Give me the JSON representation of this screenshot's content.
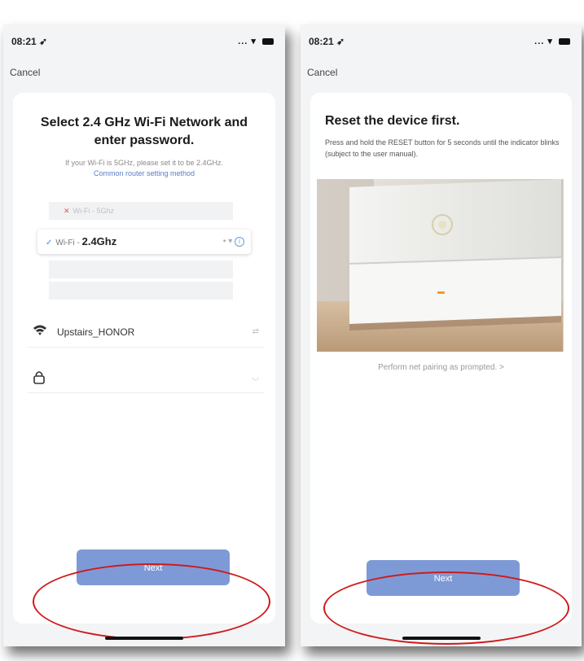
{
  "left": {
    "status_time": "08:21",
    "cancel": "Cancel",
    "title": "Select 2.4 GHz Wi-Fi Network and enter password.",
    "hint": "If your Wi-Fi is 5GHz, please set it to be 2.4GHz.",
    "hint_link": "Common router setting method",
    "illustration": {
      "row_5g": "Wi-Fi - 5Ghz",
      "row_24_prefix": "Wi-Fi - ",
      "row_24_band": "2.4Ghz"
    },
    "wifi_name": "Upstairs_HONOR",
    "next_label": "Next"
  },
  "right": {
    "status_time": "08:21",
    "cancel": "Cancel",
    "title": "Reset the device first.",
    "description": "Press and hold the RESET button for 5 seconds until the indicator blinks (subject to the user manual).",
    "link": "Perform net pairing as prompted. >",
    "next_label": "Next"
  },
  "colors": {
    "button": "#7e9ad6",
    "annotation_ring": "#cf1a1a",
    "link": "#5b7ec8"
  },
  "icons": [
    "location-arrow-icon",
    "wifi-icon",
    "battery-icon",
    "lock-icon",
    "check-icon",
    "close-icon",
    "info-icon",
    "chevron-down-icon"
  ]
}
